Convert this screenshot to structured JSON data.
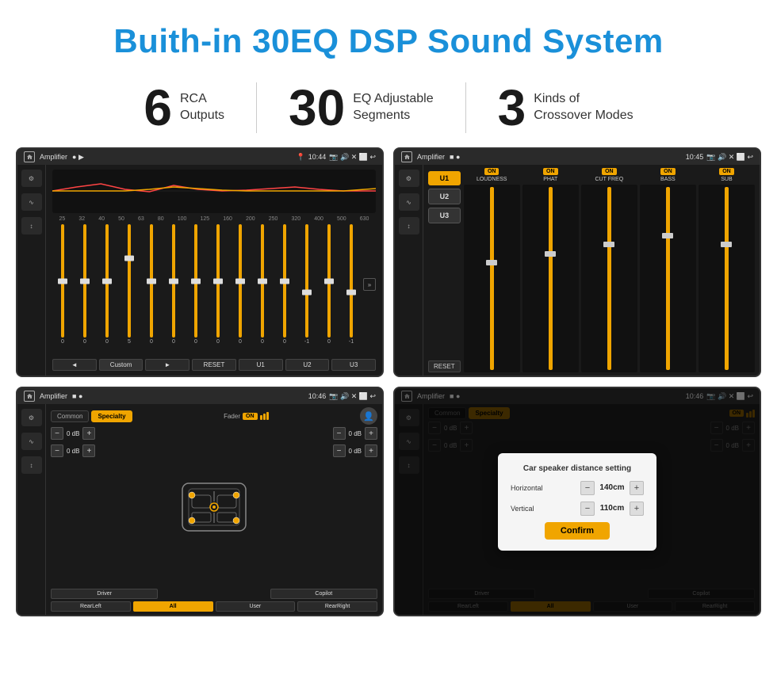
{
  "page": {
    "title": "Buith-in 30EQ DSP Sound System",
    "stats": [
      {
        "number": "6",
        "text": "RCA\nOutputs"
      },
      {
        "number": "30",
        "text": "EQ Adjustable\nSegments"
      },
      {
        "number": "3",
        "text": "Kinds of\nCrossover Modes"
      }
    ],
    "dividers": [
      "|",
      "|"
    ]
  },
  "screens": [
    {
      "id": "eq-screen",
      "title": "Amplifier",
      "time": "10:44",
      "type": "eq",
      "eq_labels": [
        "25",
        "32",
        "40",
        "50",
        "63",
        "80",
        "100",
        "125",
        "160",
        "200",
        "250",
        "320",
        "400",
        "500",
        "630"
      ],
      "eq_values": [
        "0",
        "0",
        "0",
        "5",
        "0",
        "0",
        "0",
        "0",
        "0",
        "0",
        "0",
        "-1",
        "0",
        "-1",
        ""
      ],
      "eq_preset": "Custom",
      "bottom_buttons": [
        "◄",
        "Custom",
        "►",
        "RESET",
        "U1",
        "U2",
        "U3"
      ]
    },
    {
      "id": "crossover-screen",
      "title": "Amplifier",
      "time": "10:45",
      "type": "crossover",
      "presets": [
        "U1",
        "U2",
        "U3"
      ],
      "channels": [
        {
          "name": "LOUDNESS",
          "on": true
        },
        {
          "name": "PHAT",
          "on": true
        },
        {
          "name": "CUT FREQ",
          "on": true
        },
        {
          "name": "BASS",
          "on": true
        },
        {
          "name": "SUB",
          "on": true
        }
      ],
      "reset_label": "RESET"
    },
    {
      "id": "speaker-screen",
      "title": "Amplifier",
      "time": "10:46",
      "type": "speaker",
      "tabs": [
        "Common",
        "Specialty"
      ],
      "active_tab": "Specialty",
      "fader_label": "Fader",
      "fader_on": "ON",
      "vol_rows": [
        {
          "value": "0 dB"
        },
        {
          "value": "0 dB"
        },
        {
          "value": "0 dB"
        },
        {
          "value": "0 dB"
        }
      ],
      "bottom_buttons": [
        "Driver",
        "",
        "Copilot",
        "RearLeft",
        "All",
        "",
        "User",
        "RearRight"
      ],
      "active_bottom": "All"
    },
    {
      "id": "speaker-dialog-screen",
      "title": "Amplifier",
      "time": "10:46",
      "type": "speaker-dialog",
      "tabs": [
        "Common",
        "Specialty"
      ],
      "active_tab": "Specialty",
      "fader_on": "ON",
      "dialog": {
        "title": "Car speaker distance setting",
        "horizontal_label": "Horizontal",
        "horizontal_value": "140cm",
        "vertical_label": "Vertical",
        "vertical_value": "110cm",
        "confirm_label": "Confirm"
      },
      "bottom_buttons": [
        "Driver",
        "RearLeft",
        "",
        "User",
        "RearRight"
      ],
      "vol_rows": [
        {
          "value": "0 dB"
        },
        {
          "value": "0 dB"
        }
      ]
    }
  ]
}
